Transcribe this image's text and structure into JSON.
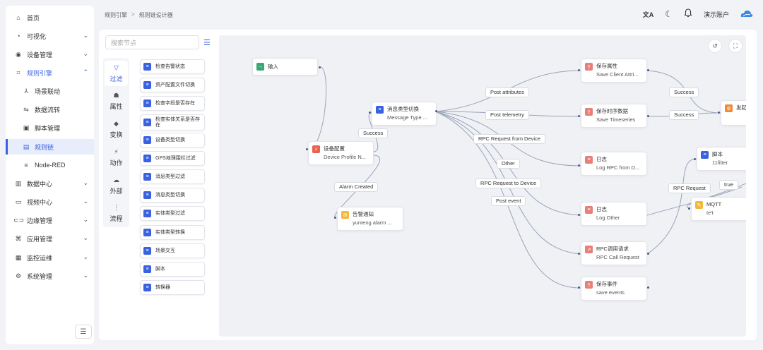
{
  "sidebar": {
    "items": [
      {
        "label": "首页",
        "icon": "home-icon",
        "glyph": "⌂",
        "chevron": ""
      },
      {
        "label": "可视化",
        "icon": "dashboard-icon",
        "glyph": "◔",
        "chevron": "⌄"
      },
      {
        "label": "设备管理",
        "icon": "device-icon",
        "glyph": "◉",
        "chevron": "⌄"
      },
      {
        "label": "规则引擎",
        "icon": "rule-engine-icon",
        "glyph": "⌗",
        "chevron": "⌃"
      },
      {
        "label": "场景联动",
        "icon": "scene-icon",
        "glyph": "⅄",
        "chevron": ""
      },
      {
        "label": "数据流转",
        "icon": "flow-icon",
        "glyph": "⇋",
        "chevron": ""
      },
      {
        "label": "脚本管理",
        "icon": "script-icon",
        "glyph": "▣",
        "chevron": ""
      },
      {
        "label": "规则链",
        "icon": "rule-chain-icon",
        "glyph": "▤",
        "chevron": ""
      },
      {
        "label": "Node-RED",
        "icon": "node-red-icon",
        "glyph": "≡",
        "chevron": ""
      },
      {
        "label": "数据中心",
        "icon": "data-center-icon",
        "glyph": "▥",
        "chevron": "⌄"
      },
      {
        "label": "视频中心",
        "icon": "video-icon",
        "glyph": "▭",
        "chevron": "⌄"
      },
      {
        "label": "边缘管理",
        "icon": "edge-icon",
        "glyph": "⊂⊃",
        "chevron": "⌄"
      },
      {
        "label": "应用管理",
        "icon": "app-icon",
        "glyph": "⌘",
        "chevron": "⌄"
      },
      {
        "label": "监控运维",
        "icon": "monitor-icon",
        "glyph": "▦",
        "chevron": "⌄"
      },
      {
        "label": "系统管理",
        "icon": "settings-icon",
        "glyph": "⚙",
        "chevron": "⌄"
      }
    ],
    "collapse_glyph": "☰"
  },
  "header": {
    "breadcrumb": [
      "规则引擎",
      "规则链设计器"
    ],
    "breadcrumb_sep": ">",
    "icons": {
      "translate": "文A",
      "theme": "☾",
      "bell": "♫"
    },
    "account": "演示账户"
  },
  "panel": {
    "search_placeholder": "搜索节点",
    "list_toggle": "☰",
    "categories": [
      {
        "label": "过滤",
        "glyph": "▽",
        "icon": "filter-icon"
      },
      {
        "label": "属性",
        "glyph": "☗",
        "icon": "attribute-icon"
      },
      {
        "label": "变换",
        "glyph": "◆",
        "icon": "transform-icon"
      },
      {
        "label": "动作",
        "glyph": "⚡",
        "icon": "action-icon"
      },
      {
        "label": "外部",
        "glyph": "☁",
        "icon": "external-icon"
      },
      {
        "label": "流程",
        "glyph": "⋮",
        "icon": "flow-process-icon"
      }
    ],
    "nodes": [
      "检查告警状态",
      "资产配置文件切换",
      "检查字段是否存在",
      "检查实体关系是否存在",
      "设备类型切换",
      "GPS地理围栏过滤",
      "消息类型过滤",
      "消息类型切换",
      "实体类型过滤",
      "实体类型转换",
      "场景交互",
      "脚本",
      "转换器"
    ]
  },
  "canvas": {
    "undo_glyph": "↺",
    "fullscreen_glyph": "⛶",
    "nodes": [
      {
        "id": "input",
        "title": "输入",
        "sub": "",
        "color": "#3aa876",
        "glyph": "→"
      },
      {
        "id": "device_profile",
        "title": "设备配置",
        "sub": "Device Profile N...",
        "color": "#e8634e",
        "glyph": "⚡"
      },
      {
        "id": "msg_switch",
        "title": "消息类型切换",
        "sub": "Message Type ...",
        "color": "#3a62e0",
        "glyph": "≡"
      },
      {
        "id": "alarm_notify",
        "title": "告警通知",
        "sub": "yunteng alarm ...",
        "color": "#f3b73a",
        "glyph": "✉"
      },
      {
        "id": "save_attr",
        "title": "保存属性",
        "sub": "Save Client Attri...",
        "color": "#e8807a",
        "glyph": "⇪"
      },
      {
        "id": "save_ts",
        "title": "保存时序数据",
        "sub": "Save Timeseries",
        "color": "#e8807a",
        "glyph": "⇪"
      },
      {
        "id": "log_rpc",
        "title": "日志",
        "sub": "Log RPC from D...",
        "color": "#e8807a",
        "glyph": "≡"
      },
      {
        "id": "log_other",
        "title": "日志",
        "sub": "Log Other",
        "color": "#e8807a",
        "glyph": "≡"
      },
      {
        "id": "rpc_call",
        "title": "RPC调用请求",
        "sub": "RPC Call Request",
        "color": "#e8807a",
        "glyph": "↗"
      },
      {
        "id": "save_events",
        "title": "保存事件",
        "sub": "save events",
        "color": "#e8807a",
        "glyph": "⇪"
      },
      {
        "id": "script",
        "title": "脚本",
        "sub": "11filter",
        "color": "#3a62e0",
        "glyph": "≡"
      },
      {
        "id": "mqtt",
        "title": "MQTT",
        "sub": "te't",
        "color": "#f3b73a",
        "glyph": "✎"
      },
      {
        "id": "publish",
        "title": "发起",
        "sub": "",
        "color": "#f08a3a",
        "glyph": "⚙"
      }
    ],
    "edge_labels": [
      "Success",
      "Alarm Created",
      "Post attributes",
      "Post telemetry",
      "RPC Request from Device",
      "Other",
      "RPC Request to Device",
      "Post event",
      "Success",
      "Success",
      "RPC Request",
      "true"
    ]
  }
}
